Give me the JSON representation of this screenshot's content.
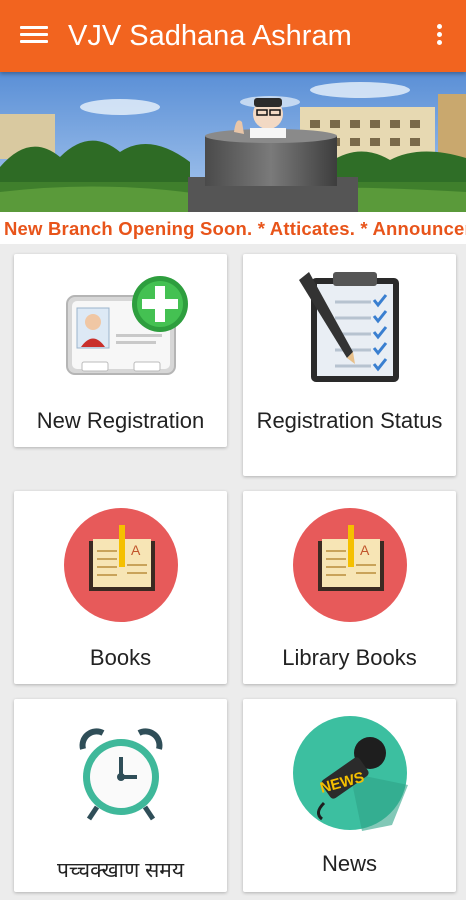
{
  "app_bar": {
    "title": "VJV Sadhana Ashram",
    "menu_icon": "hamburger-menu-icon",
    "overflow_icon": "more-vert-icon",
    "color": "#f2641f"
  },
  "ticker": {
    "text": "New Branch Opening Soon. * Atticates. * Announcements",
    "color": "#e8541a"
  },
  "tiles": [
    {
      "label": "New Registration",
      "icon": "new-registration-icon"
    },
    {
      "label": "Registration Status",
      "icon": "checklist-clipboard-icon"
    },
    {
      "label": "Books",
      "icon": "book-icon"
    },
    {
      "label": "Library Books",
      "icon": "book-icon"
    },
    {
      "label": "पच्चक्खाण समय",
      "icon": "alarm-clock-icon"
    },
    {
      "label": "News",
      "icon": "news-microphone-icon"
    }
  ]
}
